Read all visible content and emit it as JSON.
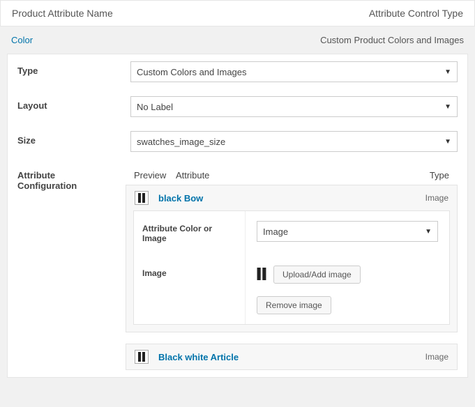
{
  "header": {
    "left": "Product Attribute Name",
    "right": "Attribute Control Type"
  },
  "subheader": {
    "left": "Color",
    "right": "Custom Product Colors and Images"
  },
  "labels": {
    "type": "Type",
    "layout": "Layout",
    "size": "Size",
    "config": "Attribute Configuration"
  },
  "fields": {
    "type": "Custom Colors and Images",
    "layout": "No Label",
    "size": "swatches_image_size"
  },
  "tableHead": {
    "preview": "Preview",
    "attribute": "Attribute",
    "type": "Type"
  },
  "attributes": [
    {
      "name": "black Bow",
      "typeLabel": "Image",
      "expanded": true
    },
    {
      "name": "Black white Article",
      "typeLabel": "Image",
      "expanded": false
    }
  ],
  "detail": {
    "colorOrImageLabel": "Attribute Color or Image",
    "colorOrImageValue": "Image",
    "imageLabel": "Image",
    "uploadBtn": "Upload/Add image",
    "removeBtn": "Remove image"
  }
}
